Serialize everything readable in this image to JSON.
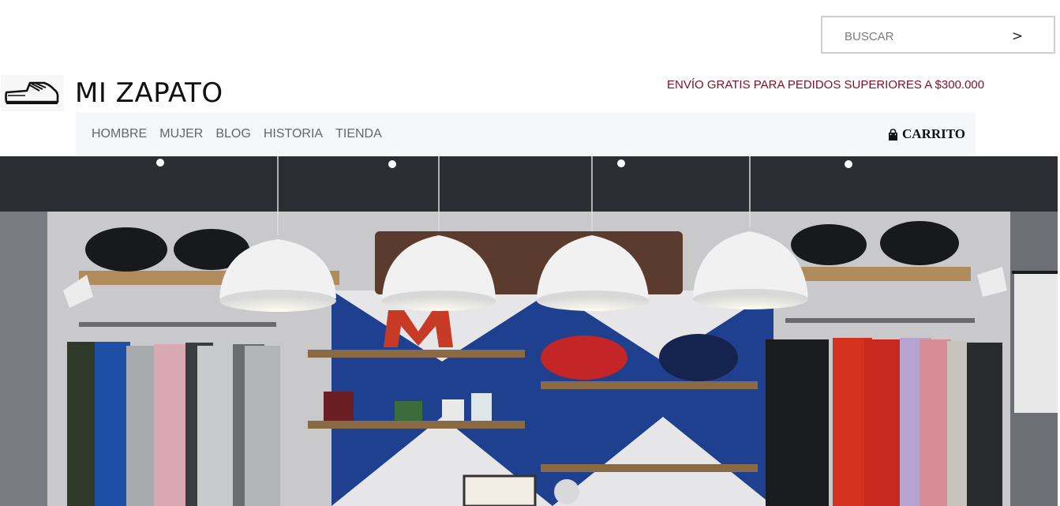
{
  "search": {
    "placeholder": "BUSCAR",
    "submit_label": ">"
  },
  "brand": {
    "name": "MI ZAPATO",
    "logo_icon": "shoe-icon"
  },
  "promo": {
    "text": "ENVÍO GRATIS PARA PEDIDOS SUPERIORES A $300.000",
    "color": "#7a1128"
  },
  "nav": {
    "items": [
      {
        "label": "HOMBRE"
      },
      {
        "label": "MUJER"
      },
      {
        "label": "BLOG"
      },
      {
        "label": "HISTORIA"
      },
      {
        "label": "TIENDA"
      }
    ],
    "cart_label": "CARRITO",
    "cart_icon": "shopping-bag-icon"
  },
  "hero": {
    "image": "clothing-store-interior-photo"
  }
}
